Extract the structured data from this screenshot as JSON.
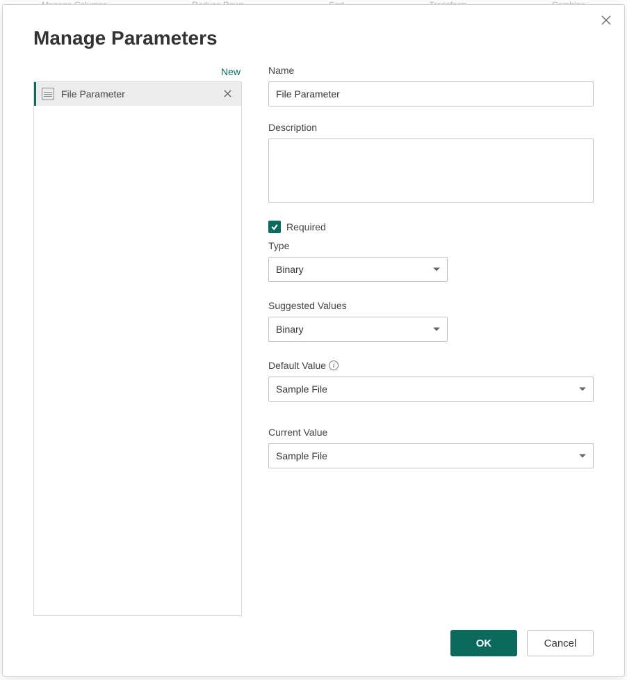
{
  "ribbon_ghost": {
    "a": "Manage Columns",
    "b": "Reduce Rows",
    "c": "Sort",
    "d": "Transform",
    "e": "Combine"
  },
  "dialog": {
    "title": "Manage Parameters",
    "new_label": "New",
    "list": {
      "items": [
        {
          "label": "File Parameter"
        }
      ]
    },
    "form": {
      "name_label": "Name",
      "name_value": "File Parameter",
      "description_label": "Description",
      "description_value": "",
      "required_label": "Required",
      "required_checked": true,
      "type_label": "Type",
      "type_value": "Binary",
      "suggested_label": "Suggested Values",
      "suggested_value": "Binary",
      "default_label": "Default Value",
      "default_value": "Sample File",
      "current_label": "Current Value",
      "current_value": "Sample File"
    },
    "buttons": {
      "ok": "OK",
      "cancel": "Cancel"
    }
  }
}
